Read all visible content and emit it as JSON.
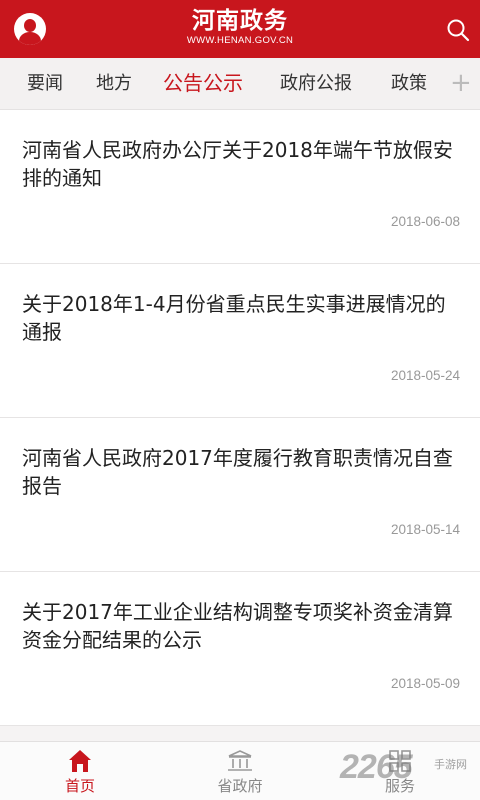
{
  "header": {
    "title": "河南政务",
    "url": "WWW.HENAN.GOV.CN"
  },
  "tabs": [
    {
      "label": "要闻"
    },
    {
      "label": "地方"
    },
    {
      "label": "公告公示",
      "active": true
    },
    {
      "label": "政府公报"
    },
    {
      "label": "政策"
    }
  ],
  "tab_add": "+",
  "articles": [
    {
      "title": "河南省人民政府办公厅关于2018年端午节放假安排的通知",
      "date": "2018-06-08"
    },
    {
      "title": "关于2018年1-4月份省重点民生实事进展情况的通报",
      "date": "2018-05-24"
    },
    {
      "title": "河南省人民政府2017年度履行教育职责情况自查报告",
      "date": "2018-05-14"
    },
    {
      "title": "关于2017年工业企业结构调整专项奖补资金清算资金分配结果的公示",
      "date": "2018-05-09"
    }
  ],
  "bottom_nav": [
    {
      "label": "首页",
      "icon": "home-icon",
      "active": true
    },
    {
      "label": "省政府",
      "icon": "building-icon"
    },
    {
      "label": "服务",
      "icon": "grid-icon"
    }
  ],
  "watermark": {
    "text": "2265",
    "sub": "手游网"
  },
  "colors": {
    "brand": "#c8161d"
  }
}
